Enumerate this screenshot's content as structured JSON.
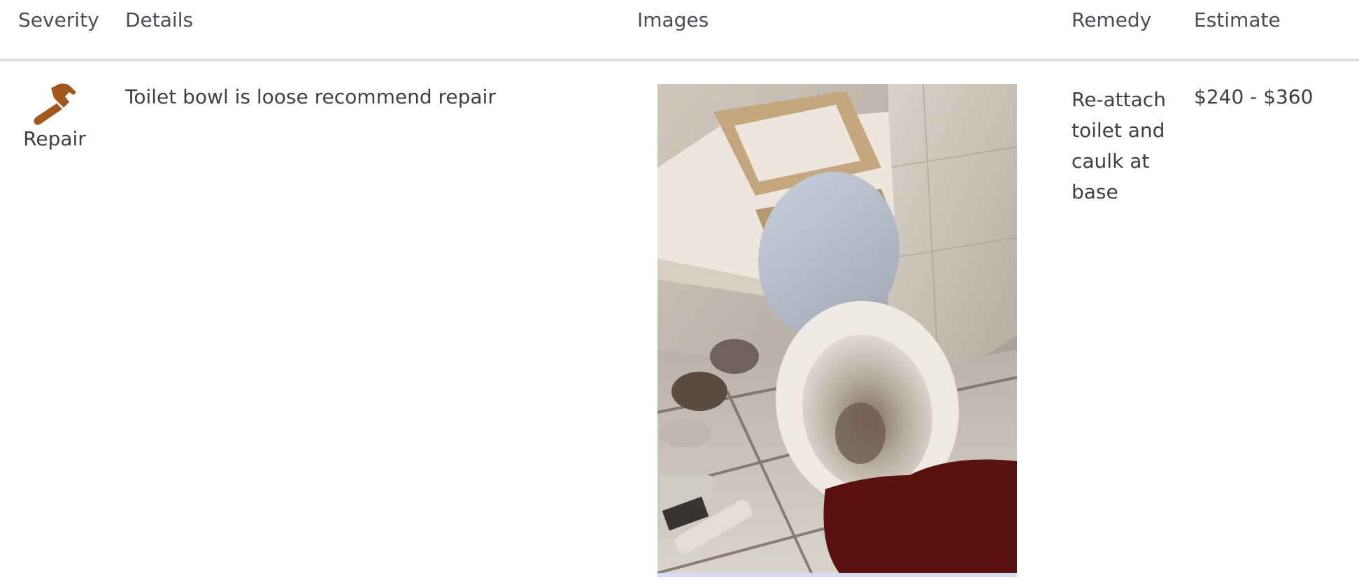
{
  "table": {
    "headers": {
      "severity": "Severity",
      "details": "Details",
      "images": "Images",
      "remedy": "Remedy",
      "estimate": "Estimate"
    },
    "rows": [
      {
        "severity": {
          "label": "Repair",
          "icon": "hammer-icon",
          "color": "#a0581e"
        },
        "details": "Toilet bowl is loose recommend repair",
        "image": {
          "subject": "toilet-photo"
        },
        "remedy": "Re-attach toilet and caulk at base",
        "estimate": "$240 - $360"
      }
    ]
  }
}
